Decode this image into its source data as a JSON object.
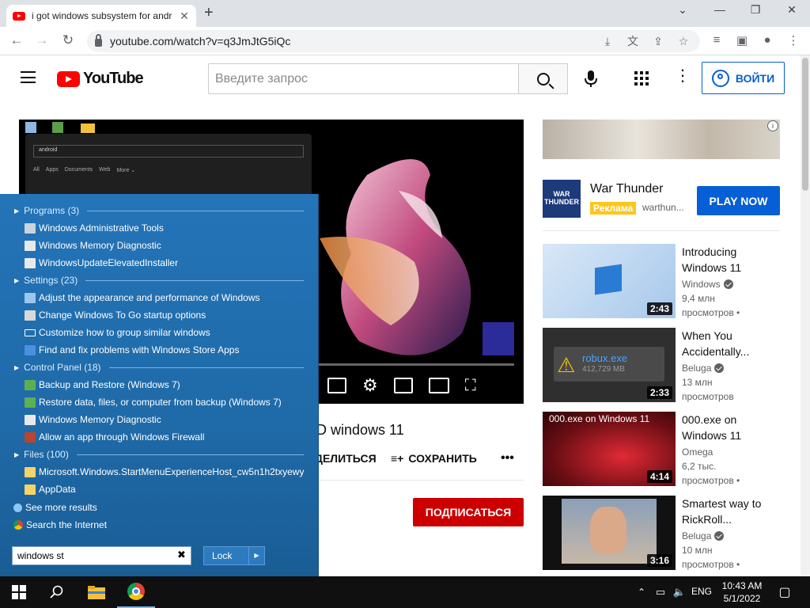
{
  "browser": {
    "tab_title": "i got windows subsystem for android",
    "tab_close": "✕",
    "new_tab": "+",
    "url": "youtube.com/watch?v=q3JmJtG5iQc",
    "window_controls": [
      "⌄",
      "—",
      "❐",
      "✕"
    ]
  },
  "youtube": {
    "logo_text": "YouTube",
    "search_placeholder": "Введите запрос",
    "signin_label": "ВОЙТИ",
    "kebab": "⋮"
  },
  "video": {
    "title": "D windows 11",
    "share_label": "ДЕЛИТЬСЯ",
    "save_label": "СОХРАНИТЬ",
    "more_label": "•••",
    "subscribe_label": "ПОДПИСАТЬСЯ",
    "inner_search_text": "android",
    "inner_tabs": [
      "All",
      "Apps",
      "Documents",
      "Web",
      "More ⌄"
    ]
  },
  "ad": {
    "logo_text": "WAR THUNDER",
    "title": "War Thunder",
    "badge": "Реклама",
    "channel": "warthun...",
    "cta": "PLAY NOW",
    "info": "i"
  },
  "recommendations": [
    {
      "title": "Introducing Windows 11",
      "channel": "Windows",
      "verified": true,
      "views": "9,4 млн",
      "age": "просмотров •",
      "duration": "2:43",
      "color": "#9fc4e8"
    },
    {
      "title": "When You Accidentally...",
      "channel": "Beluga",
      "verified": true,
      "views": "13 млн",
      "age": "просмотров",
      "duration": "2:33",
      "color": "#3b3b3b"
    },
    {
      "title": "000.exe on Windows 11",
      "channel": "Omega",
      "verified": false,
      "views": "6,2 тыс.",
      "age": "просмотров •",
      "duration": "4:14",
      "color": "#5a0d12"
    },
    {
      "title": "Smartest way to RickRoll...",
      "channel": "Beluga",
      "verified": true,
      "views": "10 млн",
      "age": "просмотров •",
      "duration": "3:16",
      "color": "#1a1a1a"
    }
  ],
  "thumb_text": {
    "robux_name": "robux.exe",
    "robux_size": "412,729 MB",
    "omega_caption": "000.exe on Windows 11"
  },
  "start_menu": {
    "categories": [
      {
        "label": "Programs (3)",
        "items": [
          "Windows Administrative Tools",
          "Windows Memory Diagnostic",
          "WindowsUpdateElevatedInstaller"
        ]
      },
      {
        "label": "Settings (23)",
        "items": [
          "Adjust the appearance and performance of Windows",
          "Change Windows To Go startup options",
          "Customize how to group similar windows",
          "Find and fix problems with Windows Store Apps"
        ]
      },
      {
        "label": "Control Panel (18)",
        "items": [
          "Backup and Restore (Windows 7)",
          "Restore data, files, or computer from backup (Windows 7)",
          "Windows Memory Diagnostic",
          "Allow an app through Windows Firewall"
        ]
      },
      {
        "label": "Files (100)",
        "items": [
          "Microsoft.Windows.StartMenuExperienceHost_cw5n1h2txyewy",
          "AppData"
        ]
      }
    ],
    "see_more": "See more results",
    "search_internet": "Search the Internet",
    "search_value": "windows st",
    "clear": "✖",
    "lock_label": "Lock",
    "lock_arrow": "▶"
  },
  "taskbar": {
    "lang": "ENG",
    "time": "10:43 AM",
    "date": "5/1/2022"
  }
}
